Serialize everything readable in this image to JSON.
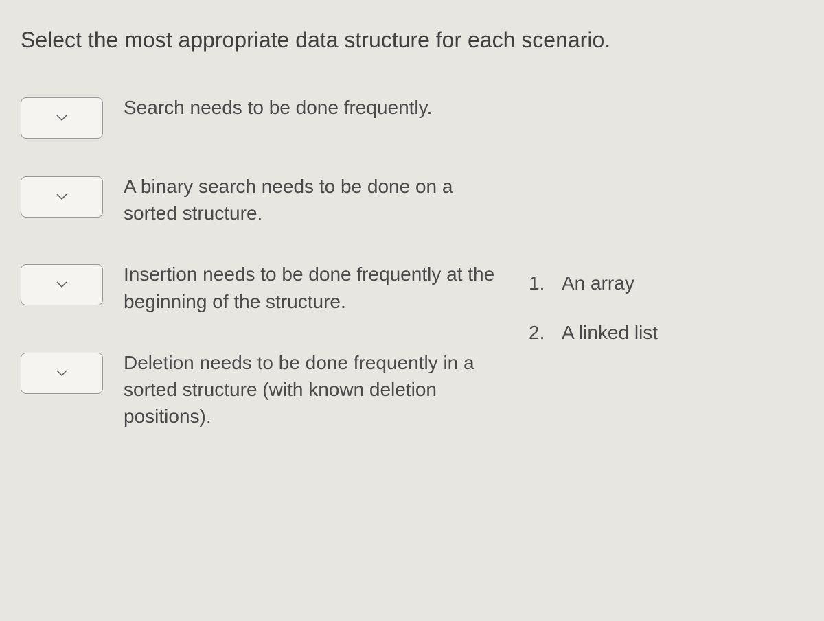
{
  "instruction": "Select the most appropriate data structure for each scenario.",
  "scenarios": [
    {
      "text": "Search needs to be done frequently."
    },
    {
      "text": "A binary search needs to be done on a sorted structure."
    },
    {
      "text": "Insertion needs to be done frequently at the beginning of the structure."
    },
    {
      "text": "Deletion needs to be done frequently in a sorted structure (with known deletion positions)."
    }
  ],
  "options": [
    {
      "number": "1.",
      "label": "An array"
    },
    {
      "number": "2.",
      "label": "A linked list"
    }
  ]
}
